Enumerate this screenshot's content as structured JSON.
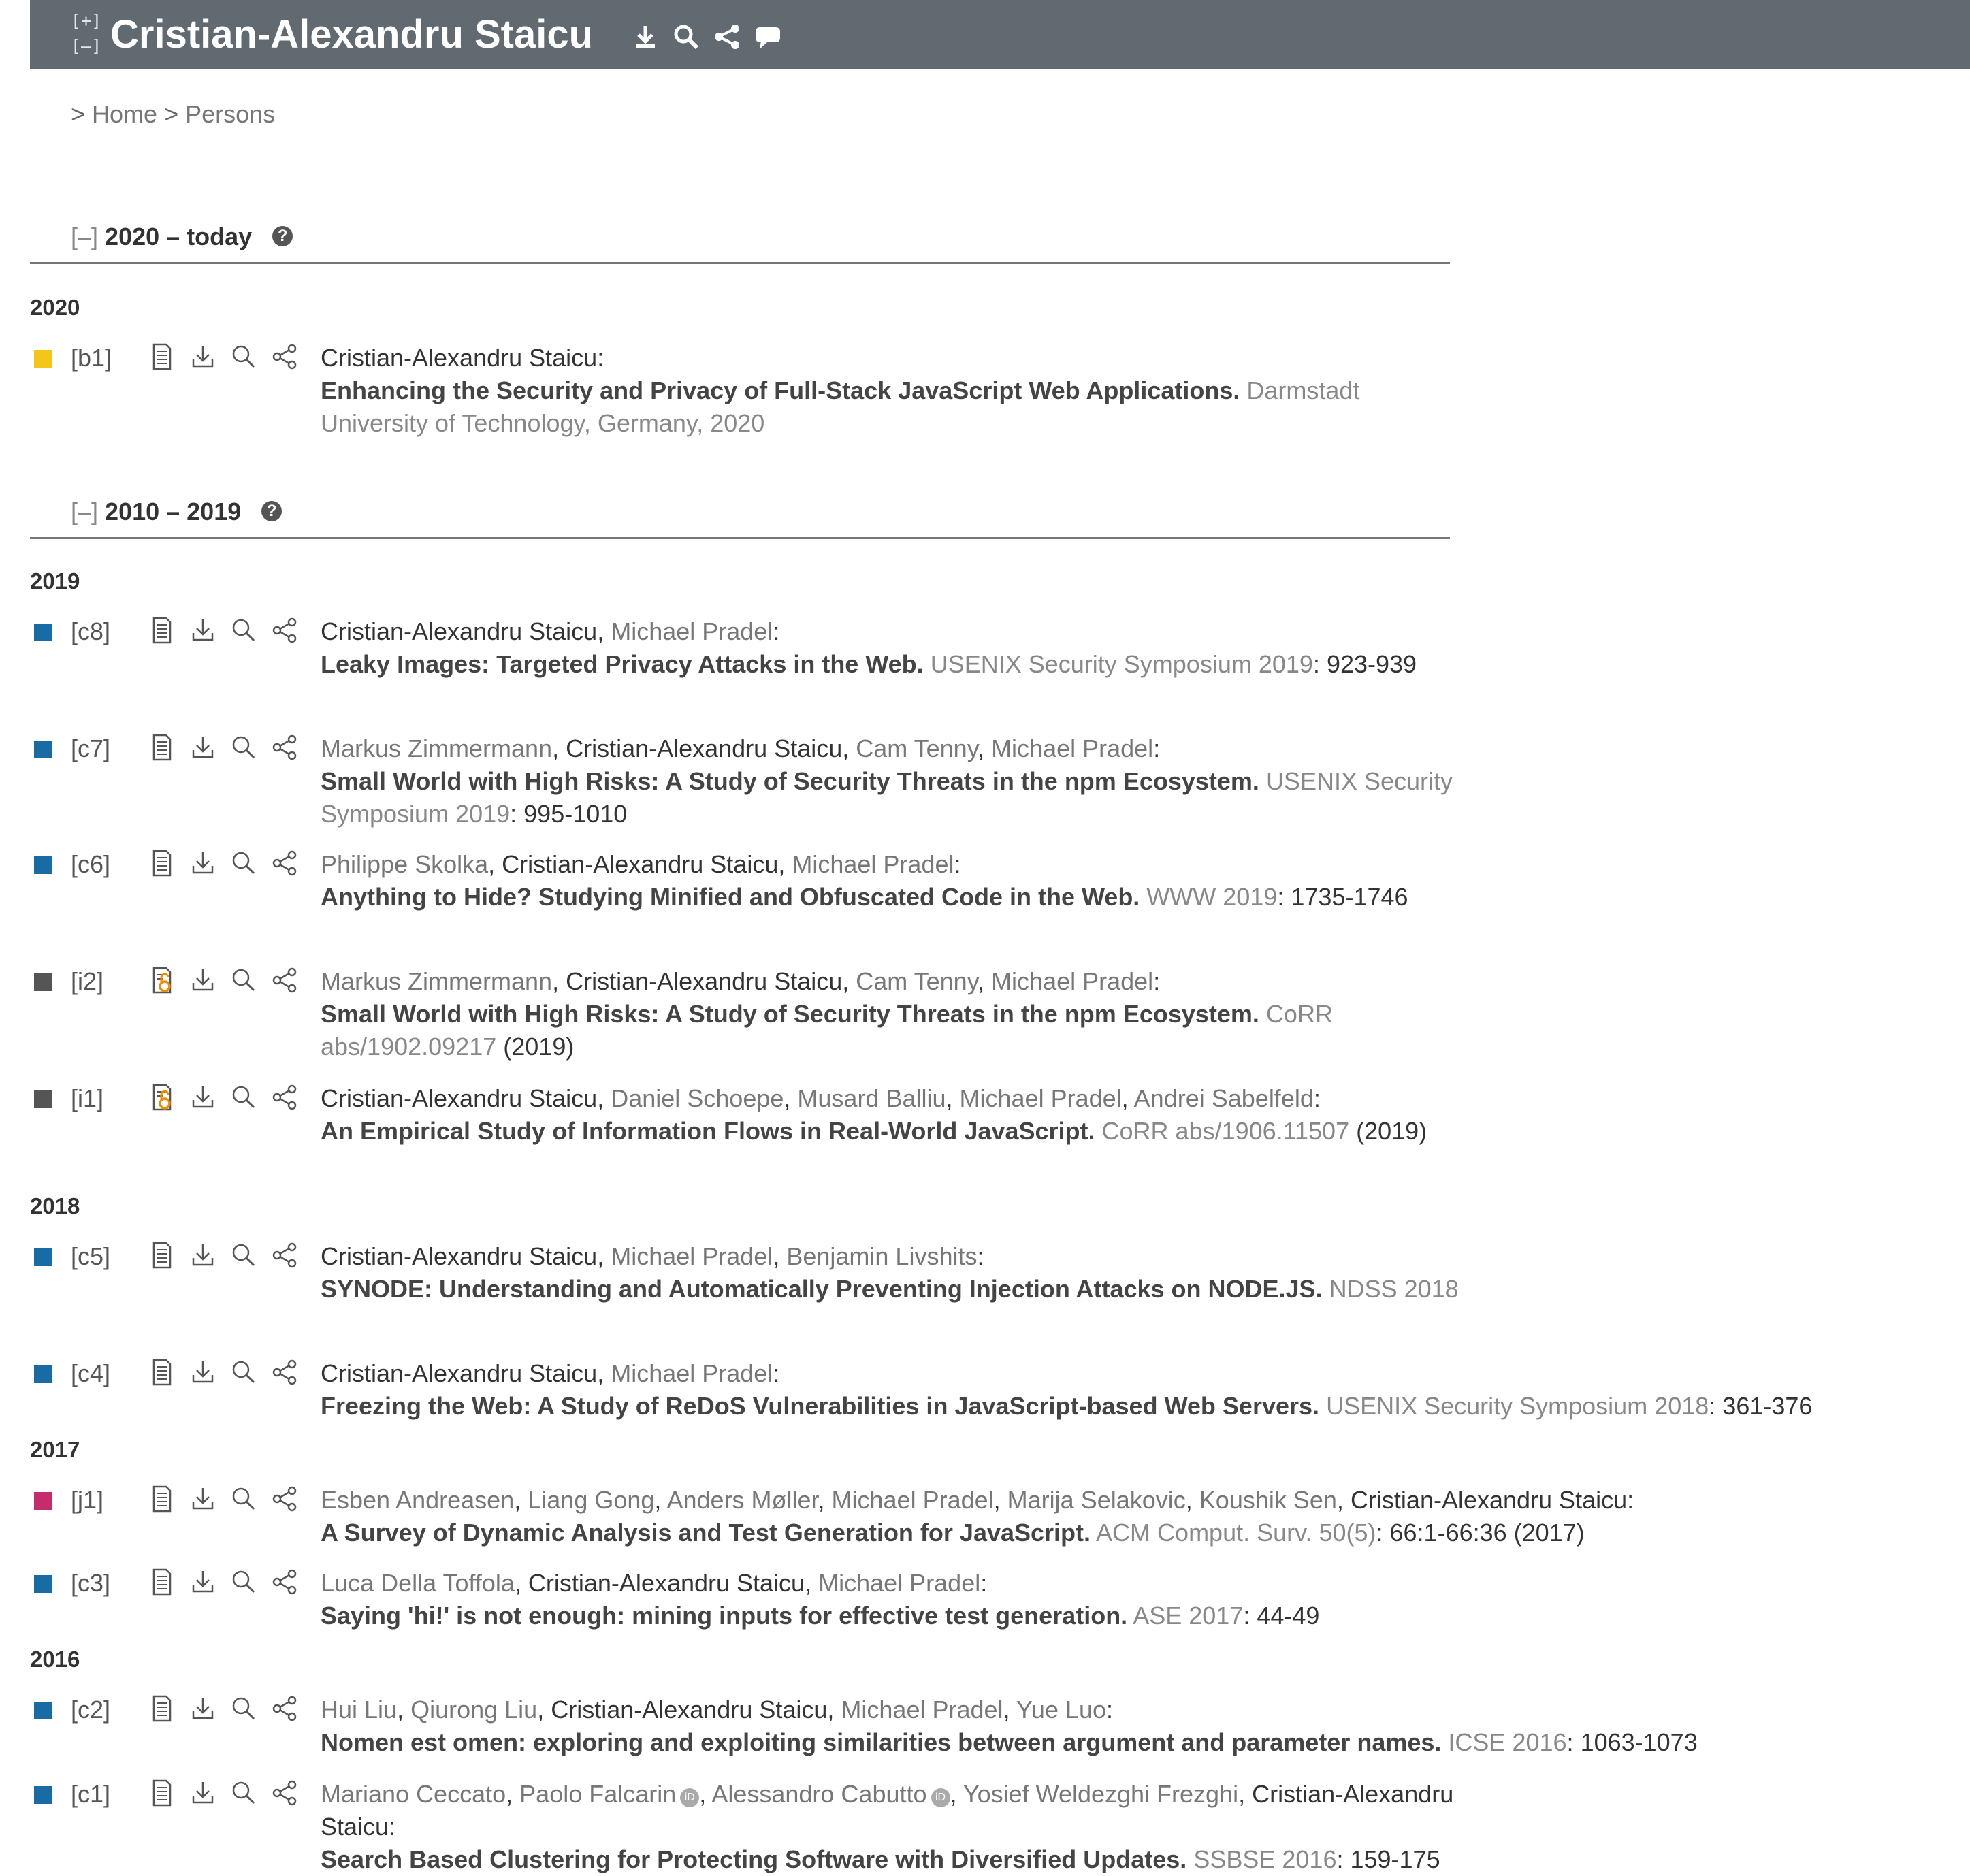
{
  "header": {
    "expand_label": "[+]",
    "collapse_label": "[–]",
    "person_name": "Cristian-Alexandru Staicu",
    "icons": [
      "download-icon",
      "search-icon",
      "share-icon",
      "comment-icon"
    ]
  },
  "breadcrumb": {
    "sep1": ">",
    "home": "Home",
    "sep2": ">",
    "persons": "Persons"
  },
  "sections": [
    {
      "toggle": "[–]",
      "label": "2020 – today",
      "help": "?"
    },
    {
      "toggle": "[–]",
      "label": "2010 – 2019",
      "help": "?"
    }
  ],
  "years": [
    "2020",
    "2019",
    "2018",
    "2017",
    "2016"
  ],
  "colors": {
    "book": "#f5c518",
    "conference": "#196ca3",
    "informal": "#555555",
    "journal": "#c52c6b",
    "header_bg": "#606a70"
  },
  "entries": [
    {
      "label": "[b1]",
      "type": "book",
      "authors": [
        {
          "name": "Cristian-Alexandru Staicu",
          "self": true
        }
      ],
      "title": "Enhancing the Security and Privacy of Full-Stack JavaScript Web Applications.",
      "venue": "Darmstadt University of Technology, Germany, 2020",
      "pages": ""
    },
    {
      "label": "[c8]",
      "type": "conference",
      "authors": [
        {
          "name": "Cristian-Alexandru Staicu",
          "self": true
        },
        {
          "name": "Michael Pradel",
          "self": false
        }
      ],
      "title": "Leaky Images: Targeted Privacy Attacks in the Web.",
      "venue": "USENIX Security Symposium 2019",
      "pages": "923-939"
    },
    {
      "label": "[c7]",
      "type": "conference",
      "authors": [
        {
          "name": "Markus Zimmermann",
          "self": false
        },
        {
          "name": "Cristian-Alexandru Staicu",
          "self": true
        },
        {
          "name": "Cam Tenny",
          "self": false
        },
        {
          "name": "Michael Pradel",
          "self": false
        }
      ],
      "title": "Small World with High Risks: A Study of Security Threats in the npm Ecosystem.",
      "venue": "USENIX Security Symposium 2019",
      "pages": "995-1010"
    },
    {
      "label": "[c6]",
      "type": "conference",
      "authors": [
        {
          "name": "Philippe Skolka",
          "self": false
        },
        {
          "name": "Cristian-Alexandru Staicu",
          "self": true
        },
        {
          "name": "Michael Pradel",
          "self": false
        }
      ],
      "title": "Anything to Hide? Studying Minified and Obfuscated Code in the Web.",
      "venue": "WWW 2019",
      "pages": "1735-1746"
    },
    {
      "label": "[i2]",
      "type": "informal",
      "authors": [
        {
          "name": "Markus Zimmermann",
          "self": false
        },
        {
          "name": "Cristian-Alexandru Staicu",
          "self": true
        },
        {
          "name": "Cam Tenny",
          "self": false
        },
        {
          "name": "Michael Pradel",
          "self": false
        }
      ],
      "title": "Small World with High Risks: A Study of Security Threats in the npm Ecosystem.",
      "venue": "CoRR abs/1902.09217",
      "pages": "(2019)"
    },
    {
      "label": "[i1]",
      "type": "informal",
      "authors": [
        {
          "name": "Cristian-Alexandru Staicu",
          "self": true
        },
        {
          "name": "Daniel Schoepe",
          "self": false
        },
        {
          "name": "Musard Balliu",
          "self": false
        },
        {
          "name": "Michael Pradel",
          "self": false
        },
        {
          "name": "Andrei Sabelfeld",
          "self": false
        }
      ],
      "title": "An Empirical Study of Information Flows in Real-World JavaScript.",
      "venue": "CoRR abs/1906.11507",
      "pages": "(2019)"
    },
    {
      "label": "[c5]",
      "type": "conference",
      "authors": [
        {
          "name": "Cristian-Alexandru Staicu",
          "self": true
        },
        {
          "name": "Michael Pradel",
          "self": false
        },
        {
          "name": "Benjamin Livshits",
          "self": false
        }
      ],
      "title": "SYNODE: Understanding and Automatically Preventing Injection Attacks on NODE.JS.",
      "venue": "NDSS 2018",
      "pages": ""
    },
    {
      "label": "[c4]",
      "type": "conference",
      "authors": [
        {
          "name": "Cristian-Alexandru Staicu",
          "self": true
        },
        {
          "name": "Michael Pradel",
          "self": false
        }
      ],
      "title": "Freezing the Web: A Study of ReDoS Vulnerabilities in JavaScript-based Web Servers.",
      "venue": "USENIX Security Symposium 2018",
      "pages": "361-376"
    },
    {
      "label": "[j1]",
      "type": "journal",
      "authors": [
        {
          "name": "Esben Andreasen",
          "self": false
        },
        {
          "name": "Liang Gong",
          "self": false
        },
        {
          "name": "Anders Møller",
          "self": false
        },
        {
          "name": "Michael Pradel",
          "self": false
        },
        {
          "name": "Marija Selakovic",
          "self": false
        },
        {
          "name": "Koushik Sen",
          "self": false
        },
        {
          "name": "Cristian-Alexandru Staicu",
          "self": true
        }
      ],
      "title": "A Survey of Dynamic Analysis and Test Generation for JavaScript.",
      "venue": "ACM Comput. Surv. 50(5)",
      "pages": "66:1-66:36 (2017)"
    },
    {
      "label": "[c3]",
      "type": "conference",
      "authors": [
        {
          "name": "Luca Della Toffola",
          "self": false
        },
        {
          "name": "Cristian-Alexandru Staicu",
          "self": true
        },
        {
          "name": "Michael Pradel",
          "self": false
        }
      ],
      "title": "Saying 'hi!' is not enough: mining inputs for effective test generation.",
      "venue": "ASE 2017",
      "pages": "44-49"
    },
    {
      "label": "[c2]",
      "type": "conference",
      "authors": [
        {
          "name": "Hui Liu",
          "self": false
        },
        {
          "name": "Qiurong Liu",
          "self": false
        },
        {
          "name": "Cristian-Alexandru Staicu",
          "self": true
        },
        {
          "name": "Michael Pradel",
          "self": false
        },
        {
          "name": "Yue Luo",
          "self": false
        }
      ],
      "title": "Nomen est omen: exploring and exploiting similarities between argument and parameter names.",
      "venue": "ICSE 2016",
      "pages": "1063-1073"
    },
    {
      "label": "[c1]",
      "type": "conference",
      "authors": [
        {
          "name": "Mariano Ceccato",
          "self": false
        },
        {
          "name": "Paolo Falcarin",
          "self": false,
          "orcid": true
        },
        {
          "name": "Alessandro Cabutto",
          "self": false,
          "orcid": true
        },
        {
          "name": "Yosief Weldezghi Frezghi",
          "self": false
        },
        {
          "name": "Cristian-Alexandru Staicu",
          "self": true
        }
      ],
      "title": "Search Based Clustering for Protecting Software with Diversified Updates.",
      "venue": "SSBSE 2016",
      "pages": "159-175"
    }
  ]
}
